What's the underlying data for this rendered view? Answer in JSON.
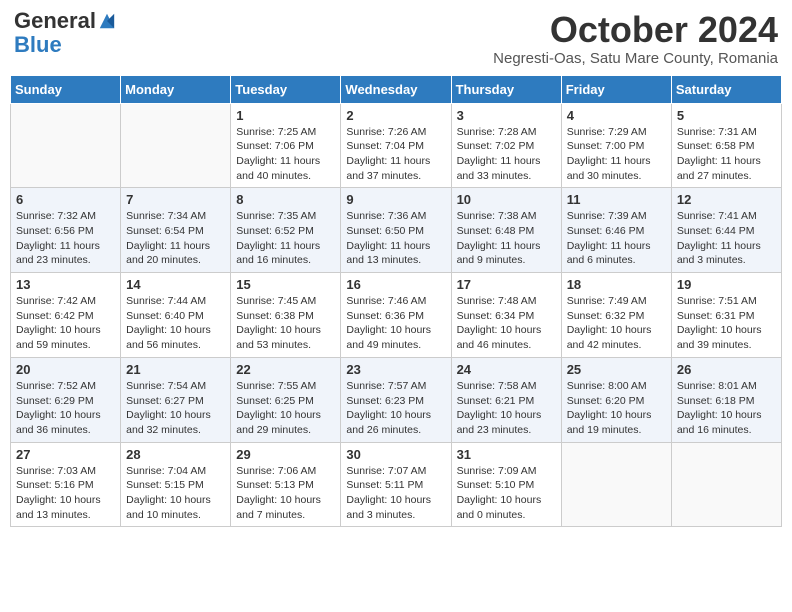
{
  "header": {
    "logo": {
      "line1": "General",
      "line2": "Blue"
    },
    "title": "October 2024",
    "subtitle": "Negresti-Oas, Satu Mare County, Romania"
  },
  "days_of_week": [
    "Sunday",
    "Monday",
    "Tuesday",
    "Wednesday",
    "Thursday",
    "Friday",
    "Saturday"
  ],
  "weeks": [
    [
      {
        "day": "",
        "info": ""
      },
      {
        "day": "",
        "info": ""
      },
      {
        "day": "1",
        "info": "Sunrise: 7:25 AM\nSunset: 7:06 PM\nDaylight: 11 hours and 40 minutes."
      },
      {
        "day": "2",
        "info": "Sunrise: 7:26 AM\nSunset: 7:04 PM\nDaylight: 11 hours and 37 minutes."
      },
      {
        "day": "3",
        "info": "Sunrise: 7:28 AM\nSunset: 7:02 PM\nDaylight: 11 hours and 33 minutes."
      },
      {
        "day": "4",
        "info": "Sunrise: 7:29 AM\nSunset: 7:00 PM\nDaylight: 11 hours and 30 minutes."
      },
      {
        "day": "5",
        "info": "Sunrise: 7:31 AM\nSunset: 6:58 PM\nDaylight: 11 hours and 27 minutes."
      }
    ],
    [
      {
        "day": "6",
        "info": "Sunrise: 7:32 AM\nSunset: 6:56 PM\nDaylight: 11 hours and 23 minutes."
      },
      {
        "day": "7",
        "info": "Sunrise: 7:34 AM\nSunset: 6:54 PM\nDaylight: 11 hours and 20 minutes."
      },
      {
        "day": "8",
        "info": "Sunrise: 7:35 AM\nSunset: 6:52 PM\nDaylight: 11 hours and 16 minutes."
      },
      {
        "day": "9",
        "info": "Sunrise: 7:36 AM\nSunset: 6:50 PM\nDaylight: 11 hours and 13 minutes."
      },
      {
        "day": "10",
        "info": "Sunrise: 7:38 AM\nSunset: 6:48 PM\nDaylight: 11 hours and 9 minutes."
      },
      {
        "day": "11",
        "info": "Sunrise: 7:39 AM\nSunset: 6:46 PM\nDaylight: 11 hours and 6 minutes."
      },
      {
        "day": "12",
        "info": "Sunrise: 7:41 AM\nSunset: 6:44 PM\nDaylight: 11 hours and 3 minutes."
      }
    ],
    [
      {
        "day": "13",
        "info": "Sunrise: 7:42 AM\nSunset: 6:42 PM\nDaylight: 10 hours and 59 minutes."
      },
      {
        "day": "14",
        "info": "Sunrise: 7:44 AM\nSunset: 6:40 PM\nDaylight: 10 hours and 56 minutes."
      },
      {
        "day": "15",
        "info": "Sunrise: 7:45 AM\nSunset: 6:38 PM\nDaylight: 10 hours and 53 minutes."
      },
      {
        "day": "16",
        "info": "Sunrise: 7:46 AM\nSunset: 6:36 PM\nDaylight: 10 hours and 49 minutes."
      },
      {
        "day": "17",
        "info": "Sunrise: 7:48 AM\nSunset: 6:34 PM\nDaylight: 10 hours and 46 minutes."
      },
      {
        "day": "18",
        "info": "Sunrise: 7:49 AM\nSunset: 6:32 PM\nDaylight: 10 hours and 42 minutes."
      },
      {
        "day": "19",
        "info": "Sunrise: 7:51 AM\nSunset: 6:31 PM\nDaylight: 10 hours and 39 minutes."
      }
    ],
    [
      {
        "day": "20",
        "info": "Sunrise: 7:52 AM\nSunset: 6:29 PM\nDaylight: 10 hours and 36 minutes."
      },
      {
        "day": "21",
        "info": "Sunrise: 7:54 AM\nSunset: 6:27 PM\nDaylight: 10 hours and 32 minutes."
      },
      {
        "day": "22",
        "info": "Sunrise: 7:55 AM\nSunset: 6:25 PM\nDaylight: 10 hours and 29 minutes."
      },
      {
        "day": "23",
        "info": "Sunrise: 7:57 AM\nSunset: 6:23 PM\nDaylight: 10 hours and 26 minutes."
      },
      {
        "day": "24",
        "info": "Sunrise: 7:58 AM\nSunset: 6:21 PM\nDaylight: 10 hours and 23 minutes."
      },
      {
        "day": "25",
        "info": "Sunrise: 8:00 AM\nSunset: 6:20 PM\nDaylight: 10 hours and 19 minutes."
      },
      {
        "day": "26",
        "info": "Sunrise: 8:01 AM\nSunset: 6:18 PM\nDaylight: 10 hours and 16 minutes."
      }
    ],
    [
      {
        "day": "27",
        "info": "Sunrise: 7:03 AM\nSunset: 5:16 PM\nDaylight: 10 hours and 13 minutes."
      },
      {
        "day": "28",
        "info": "Sunrise: 7:04 AM\nSunset: 5:15 PM\nDaylight: 10 hours and 10 minutes."
      },
      {
        "day": "29",
        "info": "Sunrise: 7:06 AM\nSunset: 5:13 PM\nDaylight: 10 hours and 7 minutes."
      },
      {
        "day": "30",
        "info": "Sunrise: 7:07 AM\nSunset: 5:11 PM\nDaylight: 10 hours and 3 minutes."
      },
      {
        "day": "31",
        "info": "Sunrise: 7:09 AM\nSunset: 5:10 PM\nDaylight: 10 hours and 0 minutes."
      },
      {
        "day": "",
        "info": ""
      },
      {
        "day": "",
        "info": ""
      }
    ]
  ]
}
